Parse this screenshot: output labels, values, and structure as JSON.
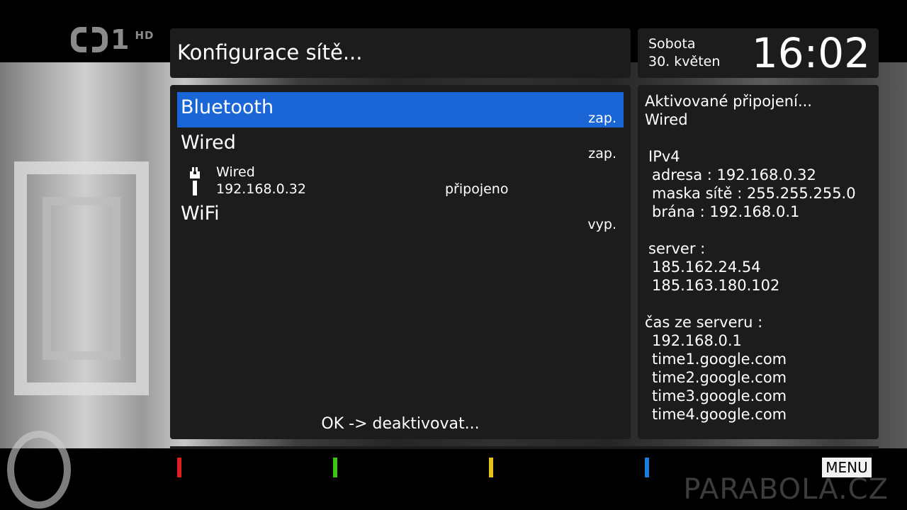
{
  "channel": {
    "logo_text": "ČT1",
    "hd_label": "HD"
  },
  "header": {
    "title": "Konfigurace sítě..."
  },
  "datetime": {
    "day": "Sobota",
    "date": "30. květen",
    "time": "16:02"
  },
  "list": {
    "rows": [
      {
        "label": "Bluetooth",
        "state": "zap.",
        "selected": true
      },
      {
        "label": "Wired",
        "state": "zap.",
        "selected": false
      },
      {
        "label": "WiFi",
        "state": "vyp.",
        "selected": false
      }
    ],
    "connection": {
      "icon": "ethernet-plug-icon",
      "name": "Wired",
      "ip": "192.168.0.32",
      "status": "připojeno"
    },
    "hint": "OK -> deaktivovat..."
  },
  "info": {
    "lines": [
      "Aktivované připojení...",
      "Wired",
      "IPv4",
      "adresa : 192.168.0.32",
      "maska sítě : 255.255.255.0",
      "brána : 192.168.0.1",
      "server :",
      "185.162.24.54",
      "185.163.180.102",
      "čas ze serveru :",
      "192.168.0.1",
      "time1.google.com",
      "time2.google.com",
      "time3.google.com",
      "time4.google.com"
    ]
  },
  "footer": {
    "color_keys": [
      {
        "name": "red",
        "color": "#e02020"
      },
      {
        "name": "green",
        "color": "#3fc21a"
      },
      {
        "name": "yellow",
        "color": "#e6c21a"
      },
      {
        "name": "blue",
        "color": "#1a7ee0"
      }
    ],
    "menu_label": "MENU",
    "watermark": "PARABOLA.CZ"
  },
  "colors": {
    "selection": "#1a66d6",
    "panel": "#1c1c1c"
  }
}
